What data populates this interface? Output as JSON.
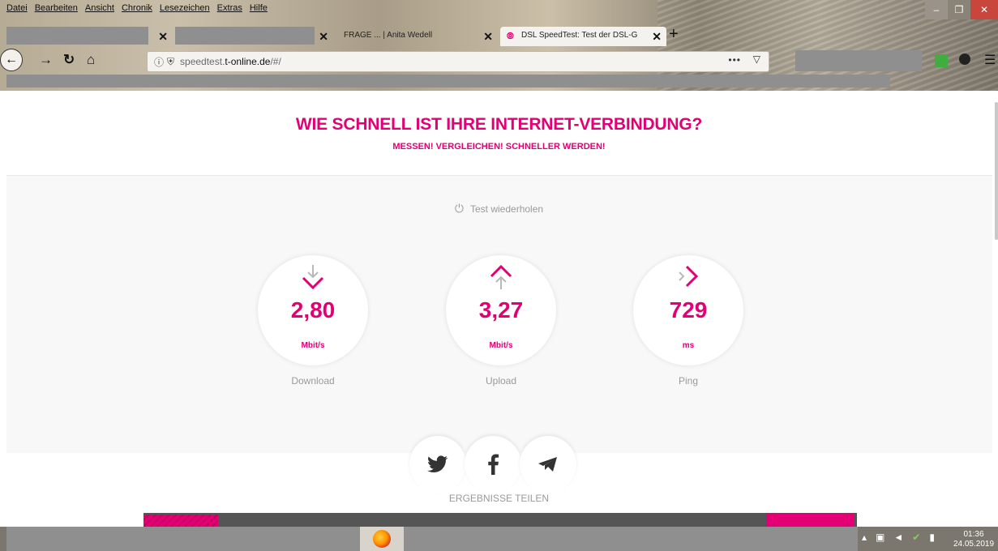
{
  "browser": {
    "menu": [
      "Datei",
      "Bearbeiten",
      "Ansicht",
      "Chronik",
      "Lesezeichen",
      "Extras",
      "Hilfe"
    ],
    "tabs": [
      {
        "label": ""
      },
      {
        "label": ""
      },
      {
        "label": "FRAGE ... | Anita Wedell"
      },
      {
        "label": "DSL SpeedTest: Test der DSL-G"
      }
    ],
    "url_prefix": "speedtest.",
    "url_domain": "t-online.de",
    "url_path": "/#/",
    "page_actions": "•••"
  },
  "page": {
    "headline": "WIE SCHNELL IST IHRE INTERNET-VERBINDUNG?",
    "subline": "MESSEN! VERGLEICHEN! SCHNELLER WERDEN!",
    "retest_label": "Test wiederholen",
    "metrics": [
      {
        "value": "2,80",
        "unit": "Mbit/s",
        "label": "Download"
      },
      {
        "value": "3,27",
        "unit": "Mbit/s",
        "label": "Upload"
      },
      {
        "value": "729",
        "unit": "ms",
        "label": "Ping"
      }
    ],
    "share_caption": "ERGEBNISSE TEILEN"
  },
  "taskbar": {
    "time": "01:36",
    "date": "24.05.2019"
  },
  "colors": {
    "brand": "#e20074",
    "muted_text": "#9a9a9a"
  }
}
